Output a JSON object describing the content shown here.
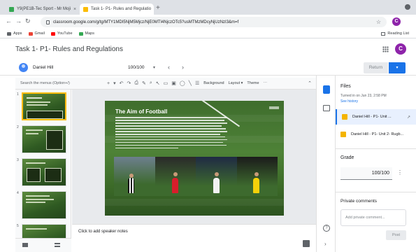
{
  "browser": {
    "tabs": [
      {
        "label": "Y9(PE1B-Tec Sport - Mr Moji",
        "active": false
      },
      {
        "label": "Task 1- P1- Rules and Regulatio",
        "active": true
      }
    ],
    "new_tab": "+",
    "close_glyph": "×",
    "url": "classroom.google.com/g/tg/MTY1MDI5NjM5Mjcz/NjE0MTI4NjczOTc5?usMTMzMDcyNjUzNzI3&m=f",
    "bookmarks": [
      {
        "label": "Apps",
        "color": "#5f6368"
      },
      {
        "label": "Gmail",
        "color": "#ea4335"
      },
      {
        "label": "YouTube",
        "color": "#ff0000"
      },
      {
        "label": "Maps",
        "color": "#34a853"
      }
    ],
    "reading_list": "Reading List",
    "profile_initial": "C"
  },
  "app": {
    "title": "Task 1- P1- Rules and Regulations",
    "avatar_initial": "C",
    "accent": "#1a73e8"
  },
  "student": {
    "name": "Daniel Hill",
    "score": "100/100",
    "prev": "‹",
    "next": "›"
  },
  "actions": {
    "return_label": "Return",
    "return_dropdown": "▾"
  },
  "editor": {
    "search_menus": "Search the menus (Option+/)",
    "menu_background": "Background",
    "menu_layout": "Layout ▾",
    "menu_theme": "Theme",
    "menu_more": "⋯",
    "slide_numbers": [
      "1",
      "2",
      "3",
      "4",
      "5"
    ],
    "speaker_notes": "Click to add speaker notes"
  },
  "slide": {
    "title": "The Aim of Football"
  },
  "panel": {
    "files_heading": "Files",
    "turned_in": "Turned in on Jun 23, 2:58 PM",
    "see_history": "See history",
    "files": [
      {
        "name": "Daniel Hill - P1- Unit ..."
      },
      {
        "name": "Daniel Hill - P1- Unit 2- Rugb..."
      }
    ],
    "grade_heading": "Grade",
    "grade_value": "100/100",
    "private_heading": "Private comments",
    "private_placeholder": "Add private comment...",
    "post_label": "Post"
  }
}
